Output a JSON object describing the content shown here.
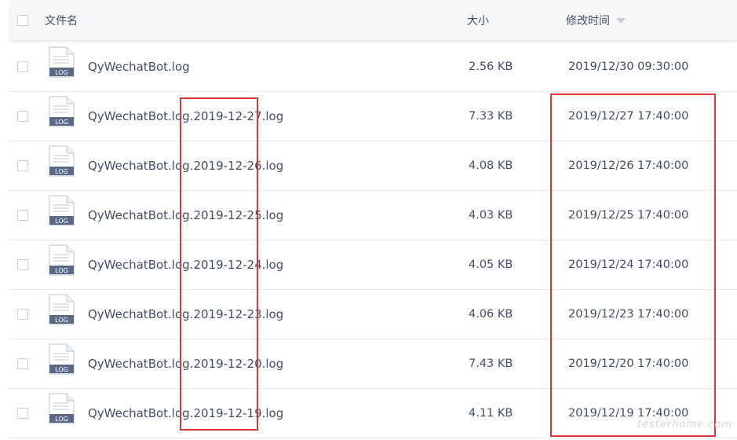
{
  "header": {
    "name_label": "文件名",
    "size_label": "大小",
    "time_label": "修改时间"
  },
  "icons": {
    "file_icon": "log-file-icon",
    "file_icon_text": "LOG",
    "sort_icon": "sort-desc-icon"
  },
  "files": [
    {
      "name": "QyWechatBot.log",
      "size": "2.56 KB",
      "time": "2019/12/30 09:30:00"
    },
    {
      "name": "QyWechatBot.log.2019-12-27.log",
      "size": "7.33 KB",
      "time": "2019/12/27 17:40:00"
    },
    {
      "name": "QyWechatBot.log.2019-12-26.log",
      "size": "4.08 KB",
      "time": "2019/12/26 17:40:00"
    },
    {
      "name": "QyWechatBot.log.2019-12-25.log",
      "size": "4.03 KB",
      "time": "2019/12/25 17:40:00"
    },
    {
      "name": "QyWechatBot.log.2019-12-24.log",
      "size": "4.05 KB",
      "time": "2019/12/24 17:40:00"
    },
    {
      "name": "QyWechatBot.log.2019-12-23.log",
      "size": "4.06 KB",
      "time": "2019/12/23 17:40:00"
    },
    {
      "name": "QyWechatBot.log.2019-12-20.log",
      "size": "7.43 KB",
      "time": "2019/12/20 17:40:00"
    },
    {
      "name": "QyWechatBot.log.2019-12-19.log",
      "size": "4.11 KB",
      "time": "2019/12/19 17:40:00"
    }
  ],
  "colors": {
    "highlight": "#e0363b",
    "text": "#424e67",
    "icon_badge": "#5a6a86"
  },
  "watermark": "testerhome.com"
}
